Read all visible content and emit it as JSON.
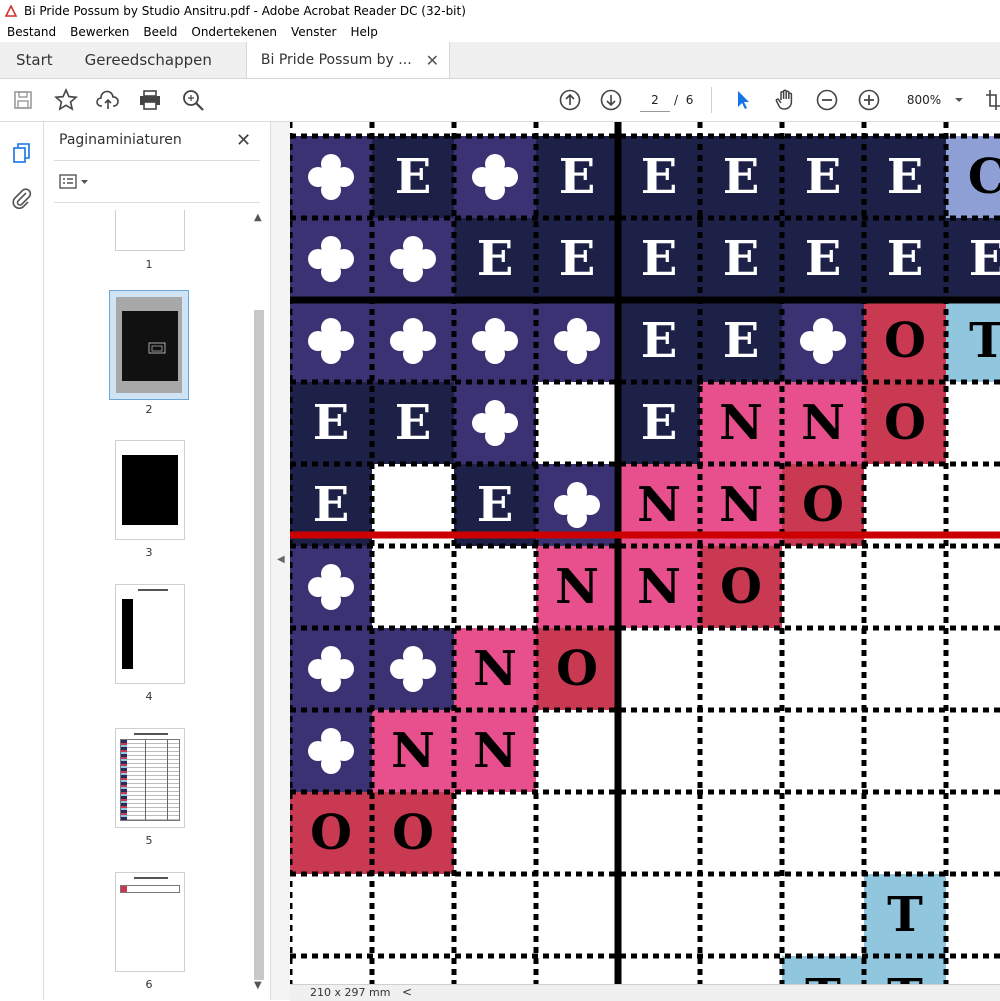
{
  "window": {
    "title": "Bi Pride Possum by Studio Ansitru.pdf - Adobe Acrobat Reader DC (32-bit)"
  },
  "menu": [
    "Bestand",
    "Bewerken",
    "Beeld",
    "Ondertekenen",
    "Venster",
    "Help"
  ],
  "tabs": {
    "start": "Start",
    "tools": "Gereedschappen",
    "document": "Bi Pride Possum by ..."
  },
  "toolbar": {
    "page_current": "2",
    "page_sep": "/",
    "page_total": "6",
    "zoom": "800%"
  },
  "thumbnails_panel": {
    "title": "Paginaminiaturen",
    "pages": [
      "1",
      "2",
      "3",
      "4",
      "5",
      "6"
    ]
  },
  "status": {
    "dimensions": "210 x 297 mm"
  },
  "colors": {
    "navy": "#1e2147",
    "purple": "#3b3274",
    "pink": "#e84f8d",
    "red": "#c93a52",
    "lightblue": "#91c7de",
    "periwinkle": "#8e9fd6",
    "redline": "#cc0000"
  },
  "grid": {
    "rows": [
      [
        "S:purple",
        "E:navy",
        "S:purple",
        "E:navy",
        "E:navy",
        "E:navy",
        "E:navy",
        "E:navy",
        "C:periwinkle"
      ],
      [
        "S:purple",
        "S:purple",
        "E:navy",
        "E:navy",
        "E:navy",
        "E:navy",
        "E:navy",
        "E:navy",
        "E:navy"
      ],
      [
        "S:purple",
        "S:purple",
        "S:purple",
        "S:purple",
        "E:navy",
        "E:navy",
        "S:purple",
        "O:red",
        "T:lightblue"
      ],
      [
        "E:navy",
        "E:navy",
        "S:purple",
        "",
        "E:navy",
        "N:pink",
        "N:pink",
        "O:red",
        ""
      ],
      [
        "E:navy",
        "",
        "E:navy",
        "S:purple",
        "N:pink",
        "N:pink",
        "O:red",
        "",
        ""
      ],
      [
        "S:purple",
        "",
        "",
        "N:pink",
        "N:pink",
        "O:red",
        "",
        "",
        ""
      ],
      [
        "S:purple",
        "S:purple",
        "N:pink",
        "O:red",
        "",
        "",
        "",
        "",
        ""
      ],
      [
        "S:purple",
        "N:pink",
        "N:pink",
        "",
        "",
        "",
        "",
        "",
        ""
      ],
      [
        "O:red",
        "O:red",
        "",
        "",
        "",
        "",
        "",
        "",
        ""
      ],
      [
        "",
        "",
        "",
        "",
        "",
        "",
        "",
        "T:lightblue",
        ""
      ],
      [
        "",
        "",
        "",
        "",
        "",
        "",
        "T:lightblue",
        "T:lightblue",
        ""
      ]
    ]
  }
}
